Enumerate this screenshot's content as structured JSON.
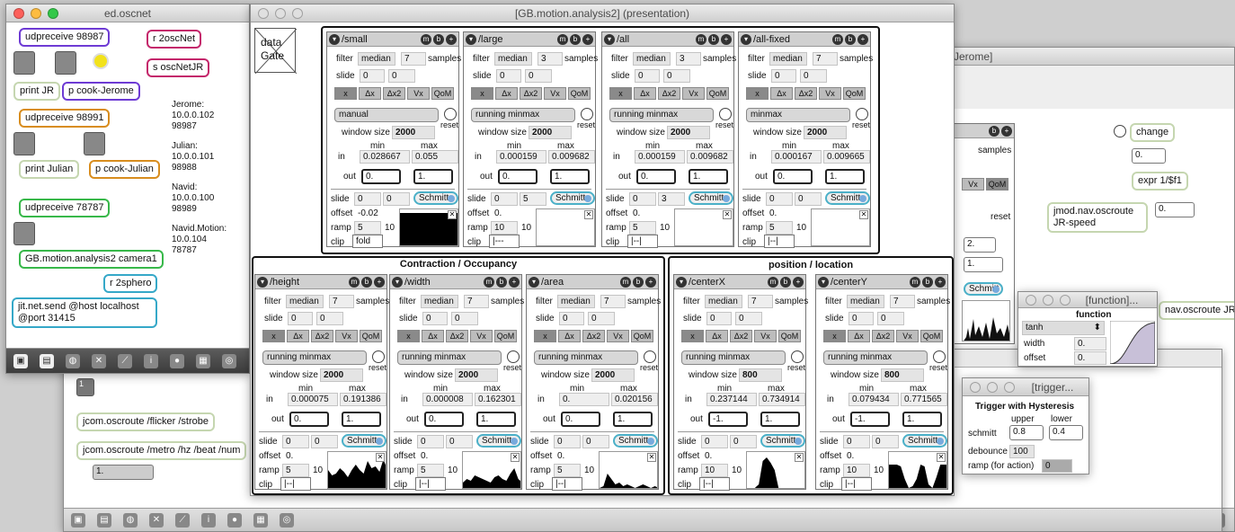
{
  "bg_window": {
    "title": "Jerome]",
    "objects": {
      "change": "change",
      "num1": "0.",
      "expr": "expr 1/$f1",
      "route": "jmod.nav.oscroute JR-speed",
      "num2": "0.",
      "route2": "nav.oscroute JR-",
      "samples": "samples",
      "x": "x",
      "vx": "Vx",
      "qom": "QoM",
      "reset": "reset",
      "num3": "2.",
      "num4": "1.",
      "schmitt": "Schmitt"
    }
  },
  "back_window": {
    "obj_route1": "jcom.oscroute /flicker /strobe",
    "obj_route2": "jcom.oscroute /metro /hz /beat /num",
    "num": "1.",
    "btn": "1"
  },
  "oscnet": {
    "title": "ed.oscnet",
    "objects": {
      "udp1": "udpreceive 98987",
      "r2osc": "r 2oscNet",
      "sosc": "s oscNetJR",
      "printjr": "print JR",
      "pcookjr": "p cook-Jerome",
      "udp2": "udpreceive 98991",
      "printjul": "print Julian",
      "pcookjul": "p cook-Julian",
      "udp3": "udpreceive 78787",
      "gbm": "GB.motion.analysis2 camera1",
      "r2sphero": "r 2sphero",
      "jitsend": "jit.net.send @host localhost @port 31415"
    },
    "info": [
      "Jerome:",
      "10.0.0.102",
      "98987",
      "Julian:",
      "10.0.0.101",
      "98988",
      "Navid:",
      "10.0.0.100",
      "98989",
      "Navid.Motion:",
      "10.0.104",
      "78787"
    ]
  },
  "main": {
    "title": "[GB.motion.analysis2] (presentation)",
    "gate_label": "data\nGate",
    "section_left": "Contraction / Occupancy",
    "section_right": "position / location",
    "labels": {
      "filter": "filter",
      "samples": "samples",
      "slide": "slide",
      "winsize": "window size",
      "min": "min",
      "max": "max",
      "in": "in",
      "out": "out",
      "offset": "offset",
      "ramp": "ramp",
      "clip": "clip",
      "reset": "reset",
      "schmitt": "Schmitt"
    },
    "tabs": [
      "x",
      "Δx",
      "Δx2",
      "Vx",
      "QoM"
    ],
    "modules": [
      {
        "name": "/small",
        "filter": "median",
        "samples": "7",
        "slide": [
          "0",
          "0"
        ],
        "mode": "manual",
        "win": "2000",
        "min": "0.028667",
        "max": "0.055",
        "out": [
          "0.",
          "1."
        ],
        "s2": [
          "0",
          "0"
        ],
        "offset": "-0.02",
        "ramp": [
          "5",
          "10"
        ],
        "clip": "fold"
      },
      {
        "name": "/large",
        "filter": "median",
        "samples": "3",
        "slide": [
          "0",
          "0"
        ],
        "mode": "running minmax",
        "win": "2000",
        "min": "0.000159",
        "max": "0.009682",
        "out": [
          "0.",
          "1."
        ],
        "s2": [
          "0",
          "5"
        ],
        "offset": "0.",
        "ramp": [
          "10",
          "10"
        ],
        "clip": "|---"
      },
      {
        "name": "/all",
        "filter": "median",
        "samples": "3",
        "slide": [
          "0",
          "0"
        ],
        "mode": "running minmax",
        "win": "2000",
        "min": "0.000159",
        "max": "0.009682",
        "out": [
          "0.",
          "1."
        ],
        "s2": [
          "0",
          "3"
        ],
        "offset": "0.",
        "ramp": [
          "5",
          "10"
        ],
        "clip": "|--|"
      },
      {
        "name": "/all-fixed",
        "filter": "median",
        "samples": "7",
        "slide": [
          "0",
          "0"
        ],
        "mode": "minmax",
        "win": "2000",
        "min": "0.000167",
        "max": "0.009665",
        "out": [
          "0.",
          "1."
        ],
        "s2": [
          "0",
          "0"
        ],
        "offset": "0.",
        "ramp": [
          "5",
          "10"
        ],
        "clip": "|--|"
      },
      {
        "name": "/height",
        "filter": "median",
        "samples": "7",
        "slide": [
          "0",
          "0"
        ],
        "mode": "running minmax",
        "win": "2000",
        "min": "0.000075",
        "max": "0.191386",
        "out": [
          "0.",
          "1."
        ],
        "s2": [
          "0",
          "0"
        ],
        "offset": "0.",
        "ramp": [
          "5",
          "10"
        ],
        "clip": "|--|"
      },
      {
        "name": "/width",
        "filter": "median",
        "samples": "7",
        "slide": [
          "0",
          "0"
        ],
        "mode": "running minmax",
        "win": "2000",
        "min": "0.000008",
        "max": "0.162301",
        "out": [
          "0.",
          "1."
        ],
        "s2": [
          "0",
          "0"
        ],
        "offset": "0.",
        "ramp": [
          "5",
          "10"
        ],
        "clip": "|--|"
      },
      {
        "name": "/area",
        "filter": "median",
        "samples": "7",
        "slide": [
          "0",
          "0"
        ],
        "mode": "running minmax",
        "win": "2000",
        "min": "0.",
        "max": "0.020156",
        "out": [
          "0.",
          "1."
        ],
        "s2": [
          "0",
          "0"
        ],
        "offset": "0.",
        "ramp": [
          "5",
          "10"
        ],
        "clip": "|--|"
      },
      {
        "name": "/centerX",
        "filter": "median",
        "samples": "7",
        "slide": [
          "0",
          "0"
        ],
        "mode": "running minmax",
        "win": "800",
        "min": "0.237144",
        "max": "0.734914",
        "out": [
          "-1.",
          "1."
        ],
        "s2": [
          "0",
          "0"
        ],
        "offset": "0.",
        "ramp": [
          "10",
          "10"
        ],
        "clip": "|--|"
      },
      {
        "name": "/centerY",
        "filter": "median",
        "samples": "7",
        "slide": [
          "0",
          "0"
        ],
        "mode": "running minmax",
        "win": "800",
        "min": "0.079434",
        "max": "0.771565",
        "out": [
          "-1.",
          "1."
        ],
        "s2": [
          "0",
          "0"
        ],
        "offset": "0.",
        "ramp": [
          "10",
          "10"
        ],
        "clip": "|--|"
      }
    ]
  },
  "func_win": {
    "title": "[function]...",
    "heading": "function",
    "select": "tanh",
    "width_label": "width",
    "width": "0.",
    "offset_label": "offset",
    "offset": "0."
  },
  "trig_win": {
    "title": "[trigger...",
    "heading": "Trigger with Hysteresis",
    "upper": "upper",
    "lower": "lower",
    "schmitt": "schmitt",
    "up": "0.8",
    "lo": "0.4",
    "debounce": "debounce",
    "deb": "100",
    "ramp": "ramp (for action)",
    "rampv": "0"
  }
}
